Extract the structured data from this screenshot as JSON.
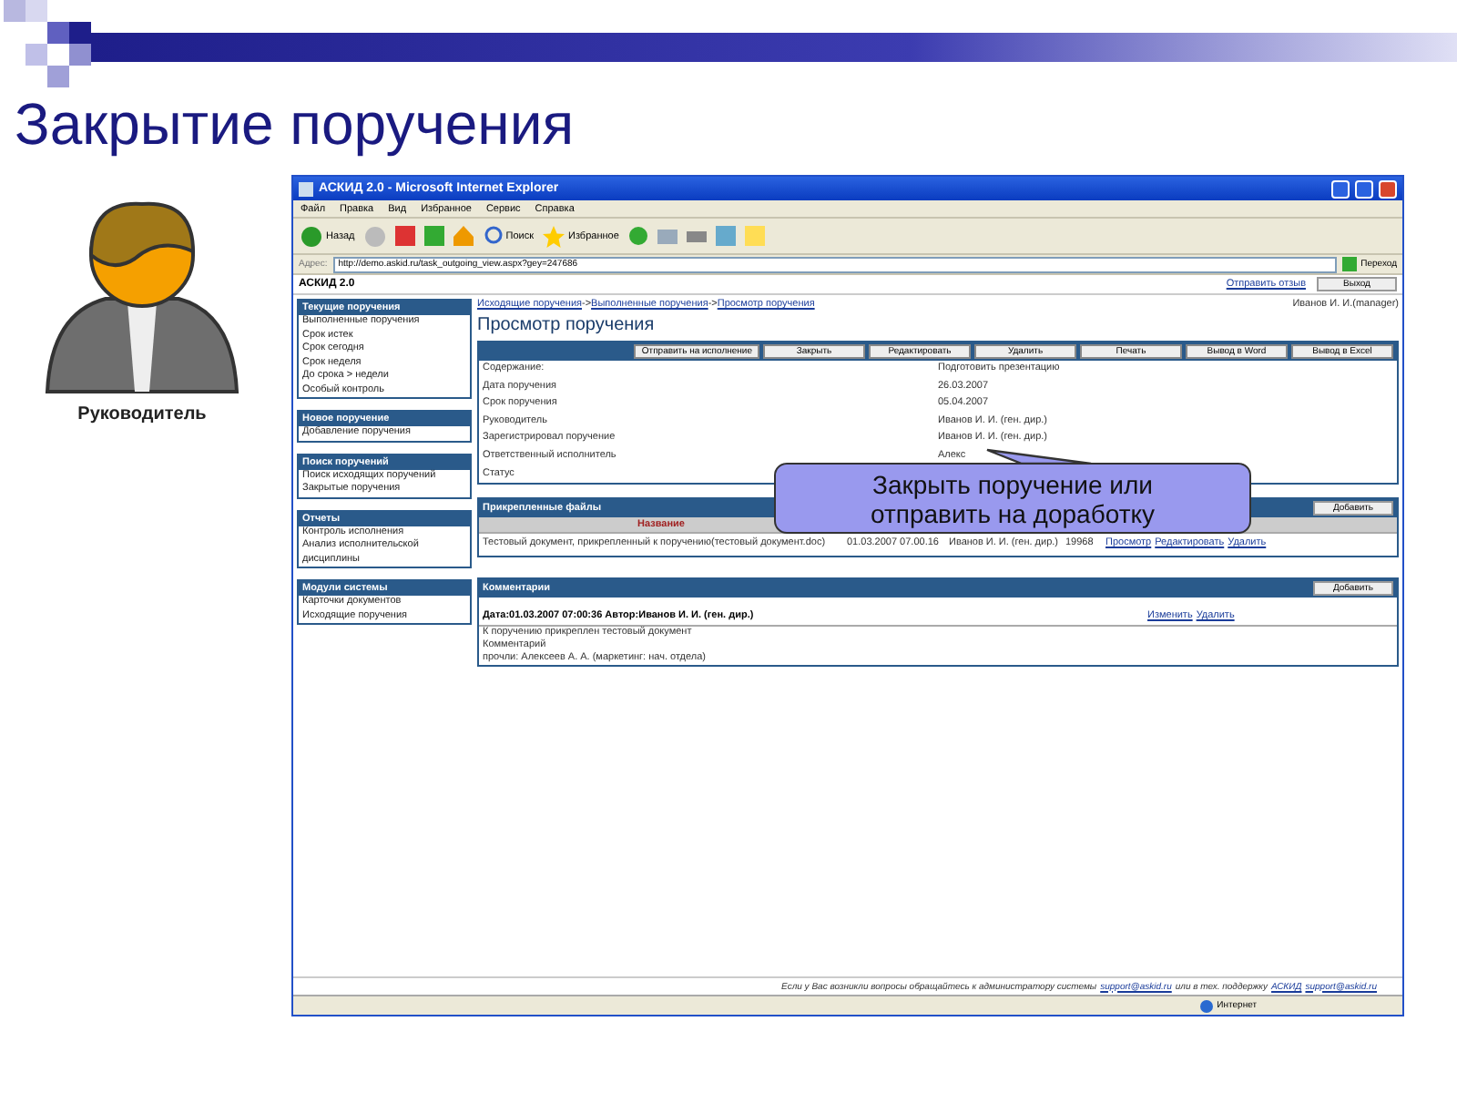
{
  "slide_title": "Закрытие поручения",
  "avatar_label": "Руководитель",
  "browser": {
    "title": "АСКИД 2.0 - Microsoft Internet Explorer",
    "menu": [
      "Файл",
      "Правка",
      "Вид",
      "Избранное",
      "Сервис",
      "Справка"
    ],
    "back": "Назад",
    "search": "Поиск",
    "favorites": "Избранное",
    "address_label": "Адрес:",
    "address": "http://demo.askid.ru/task_outgoing_view.aspx?gey=247686",
    "go": "Переход",
    "status": "Интернет"
  },
  "app": {
    "name": "АСКИД 2.0",
    "feedback": "Отправить отзыв",
    "logout": "Выход",
    "user": "Иванов И. И.(manager)"
  },
  "sidebar": [
    {
      "title": "Текущие поручения",
      "items": [
        "Выполненные поручения",
        "Срок истек",
        "Срок сегодня",
        "Срок неделя",
        "До срока > недели",
        "Особый контроль"
      ]
    },
    {
      "title": "Новое поручение",
      "items": [
        "Добавление поручения"
      ]
    },
    {
      "title": "Поиск поручений",
      "items": [
        "Поиск исходящих поручений",
        "Закрытые поручения"
      ]
    },
    {
      "title": "Отчеты",
      "items": [
        "Контроль исполнения",
        "Анализ исполнительской дисциплины"
      ]
    },
    {
      "title": "Модули системы",
      "items": [
        "Карточки документов",
        "Исходящие поручения"
      ]
    }
  ],
  "breadcrumbs": {
    "items": [
      "Исходящие поручения",
      "Выполненные поручения",
      "Просмотр поручения"
    ],
    "separator": "->"
  },
  "page_title": "Просмотр поручения",
  "actions": [
    "Отправить на исполнение",
    "Закрыть",
    "Редактировать",
    "Удалить",
    "Печать",
    "Вывод в Word",
    "Вывод в Excel"
  ],
  "fields": [
    {
      "label": "Содержание:",
      "value": "Подготовить презентацию"
    },
    {
      "label": "Дата поручения",
      "value": "26.03.2007"
    },
    {
      "label": "Срок поручения",
      "value": "05.04.2007"
    },
    {
      "label": "Руководитель",
      "value": "Иванов И. И. (ген. дир.)"
    },
    {
      "label": "Зарегистрировал поручение",
      "value": "Иванов И. И. (ген. дир.)"
    },
    {
      "label": "Ответственный исполнитель",
      "value": "Алекс"
    },
    {
      "label": "Статус"
    }
  ],
  "files": {
    "title": "Прикрепленные файлы",
    "add": "Добавить",
    "columns": [
      "Название"
    ],
    "rows": [
      {
        "name": "Тестовый документ, прикрепленный к поручению(тестовый документ.doc)",
        "date": "01.03.2007 07.00.16",
        "author": "Иванов И. И. (ген. дир.)",
        "size": "19968",
        "links": [
          "Просмотр",
          "Редактировать",
          "Удалить"
        ]
      }
    ]
  },
  "comments": {
    "title": "Комментарии",
    "add": "Добавить",
    "items": [
      {
        "header": "Дата:01.03.2007 07:00:36 Автор:Иванов И. И. (ген. дир.)",
        "links": [
          "Изменить",
          "Удалить"
        ],
        "lines": [
          "К поручению прикреплен тестовый документ",
          "Комментарий",
          "прочли: Алексеев А. А. (маркетинг: нач. отдела)"
        ]
      }
    ]
  },
  "footer": [
    {
      "kind": "text",
      "text": "Если у Вас возникли вопросы обращайтесь к администратору системы"
    },
    {
      "kind": "link",
      "text": "support@askid.ru"
    },
    {
      "kind": "text",
      "text": "или в тех. поддержку"
    },
    {
      "kind": "link",
      "text": "АСКИД"
    },
    {
      "kind": "link",
      "text": "support@askid.ru"
    }
  ],
  "callout": "Закрыть поручение или отправить на доработку"
}
